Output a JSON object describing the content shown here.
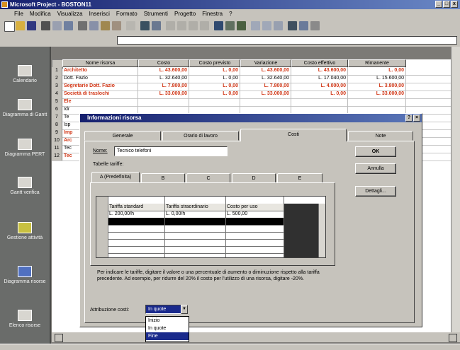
{
  "app": {
    "title": "Microsoft Project - BOSTON11",
    "window_buttons": [
      "_",
      "□",
      "x"
    ]
  },
  "menu": [
    "File",
    "Modifica",
    "Visualizza",
    "Inserisci",
    "Formato",
    "Strumenti",
    "Progetto",
    "Finestra",
    "?"
  ],
  "views": [
    "Calendario",
    "Diagramma di Gantt",
    "Diagramma PERT",
    "Gantt verifica",
    "Gestione attività",
    "Diagramma risorse",
    "Elenco risorse"
  ],
  "sheet": {
    "headers": [
      "Nome risorsa",
      "Costo",
      "Costo previsto",
      "Variazione",
      "Costo effettivo",
      "Rimanente"
    ],
    "rows": [
      {
        "n": "1",
        "name": "Architetto",
        "costo": "L. 43.600,00",
        "prev": "L. 0,00",
        "var": "L. 43.600,00",
        "eff": "L. 43.600,00",
        "rim": "L. 0,00",
        "red": true
      },
      {
        "n": "2",
        "name": "Dott. Fazio",
        "costo": "L. 32.640,00",
        "prev": "L. 0,00",
        "var": "L. 32.640,00",
        "eff": "L. 17.040,00",
        "rim": "L. 15.600,00",
        "red": false
      },
      {
        "n": "3",
        "name": "Segretarie Dott. Fazio",
        "costo": "L. 7.800,00",
        "prev": "L. 0,00",
        "var": "L. 7.800,00",
        "eff": "L. 4.000,00",
        "rim": "L. 3.800,00",
        "red": true
      },
      {
        "n": "4",
        "name": "Società di traslochi",
        "costo": "L. 33.000,00",
        "prev": "L. 0,00",
        "var": "L. 33.000,00",
        "eff": "L. 0,00",
        "rim": "L. 33.000,00",
        "red": true
      },
      {
        "n": "5",
        "name": "Ele",
        "red": true
      },
      {
        "n": "6",
        "name": "Idr",
        "red": false
      },
      {
        "n": "7",
        "name": "Te",
        "red": false
      },
      {
        "n": "8",
        "name": "Isp",
        "red": false
      },
      {
        "n": "9",
        "name": "Imp",
        "red": true
      },
      {
        "n": "10",
        "name": "Arc",
        "red": true
      },
      {
        "n": "11",
        "name": "Tec",
        "red": false
      },
      {
        "n": "12",
        "name": "Tec",
        "red": true
      }
    ]
  },
  "dialog": {
    "title": "Informazioni risorsa",
    "tabs": [
      "Generale",
      "Orario di lavoro",
      "Costi",
      "Note"
    ],
    "name_label": "Nome:",
    "name_value": "Tecnico telefoni",
    "tables_label": "Tabelle tariffe:",
    "subtabs": [
      "A (Predefinita)",
      "B",
      "C",
      "D",
      "E"
    ],
    "grid_headers": [
      "Tariffa standard",
      "Tariffa straordinario",
      "Costo per uso"
    ],
    "grid_row": [
      "L. 200,00/h",
      "L. 0,00/h",
      "L. 500,00"
    ],
    "note": "Per indicare le tariffe, digitare il valore o una percentuale di aumento o diminuzione rispetto alla tariffa precedente. Ad esempio, per ridurre del 20% il costo per l'utilizzo di una risorsa, digitare -20%.",
    "accrual_label": "Attribuzione costi:",
    "accrual_value": "In quote",
    "accrual_options": [
      "Inizio",
      "In quote",
      "Fine"
    ],
    "buttons": [
      "OK",
      "Annulla",
      "Dettagli..."
    ]
  },
  "colors": {
    "titlebar": "#16206e",
    "highlight": "#1a2a8c",
    "red_text": "#d23818"
  }
}
